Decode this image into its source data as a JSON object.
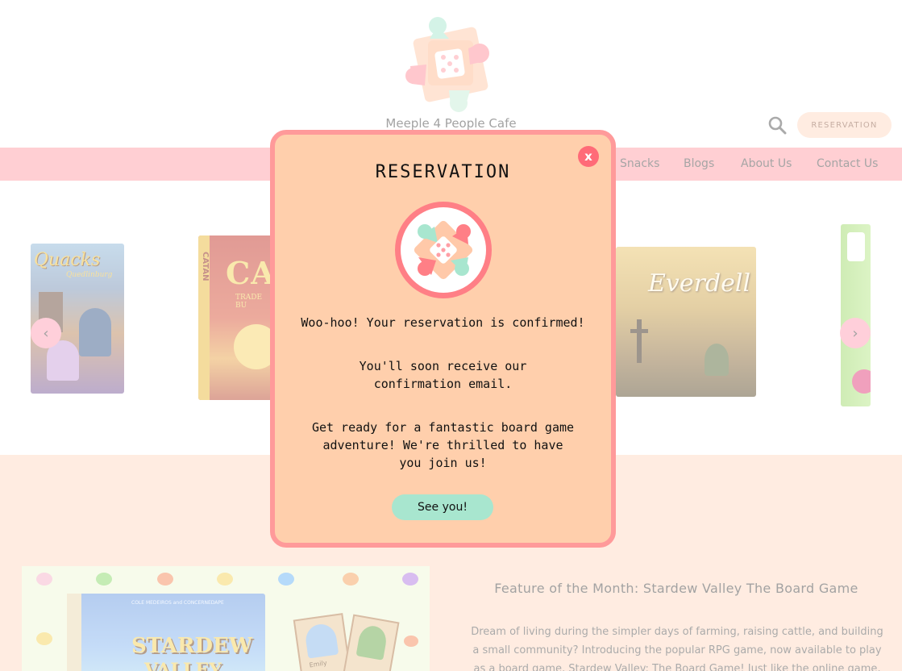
{
  "header": {
    "site_name": "Meeple 4 People Cafe",
    "reservation_button": "RESERVATION"
  },
  "nav": {
    "items": [
      "Snacks",
      "Blogs",
      "About Us",
      "Contact Us"
    ]
  },
  "carousel": {
    "games": [
      {
        "title": "Quacks",
        "subtitle": "Quedlinburg",
        "color": "#5a8fb8"
      },
      {
        "title": "CAT",
        "subtitle": "TRADE BU",
        "side": "CATAN",
        "color": "#c33c2c"
      },
      {
        "title": "Everdell",
        "color": "#c9a85a"
      }
    ],
    "prev_icon": "chevron-left-icon",
    "next_icon": "chevron-right-icon"
  },
  "feature": {
    "title": "Feature of the Month: Stardew Valley The Board Game",
    "text": "Dream of living during the simpler days of farming, raising cattle, and building a small community? Introducing the popular RPG game, now available to play as a board game, Stardew Valley: The Board Game! Just like the online game, players",
    "image_title": "STARDEW",
    "image_subtitle": "VALLEY",
    "image_credit": "COLE MEDEIROS and CONCERNEDAPE",
    "card_name": "Emily"
  },
  "modal": {
    "title": "RESERVATION",
    "close_label": "x",
    "line1": "Woo-hoo! Your reservation is confirmed!",
    "line2": "You'll soon receive our confirmation email.",
    "line3": "Get ready for a fantastic board game adventure! We're thrilled to have you join us!",
    "button": "See you!"
  },
  "colors": {
    "nav_bg": "#ff9fa6",
    "modal_bg": "#ffcfac",
    "modal_border": "#ff9a9a",
    "button_mint": "#a8e6cf",
    "feature_bg": "#ffd9c2"
  }
}
